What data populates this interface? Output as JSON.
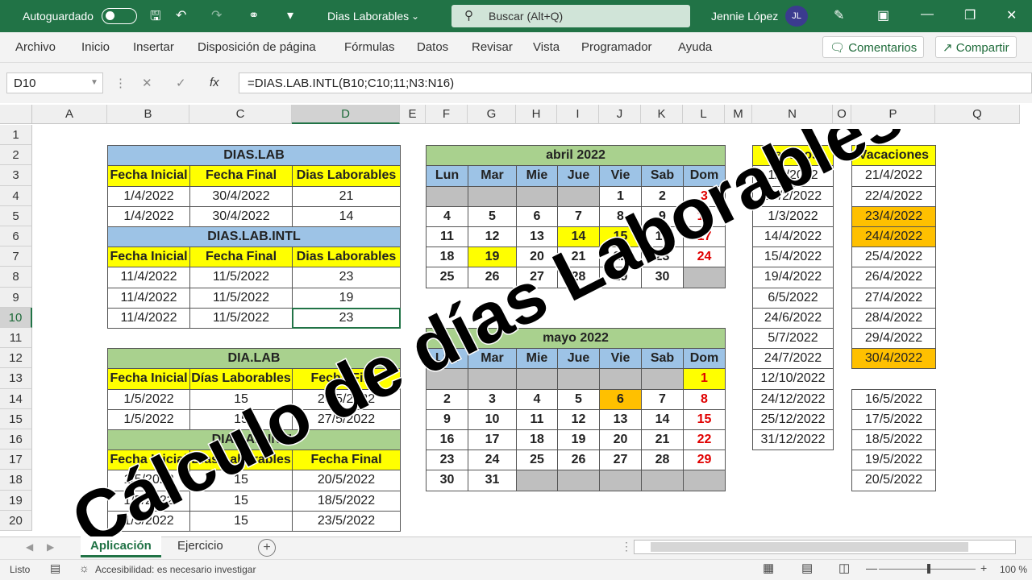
{
  "titlebar": {
    "autosave": "Autoguardado",
    "doc_title": "Dias Laborables",
    "search_placeholder": "Buscar (Alt+Q)",
    "user": "Jennie López",
    "initials": "JL"
  },
  "menu": [
    "Archivo",
    "Inicio",
    "Insertar",
    "Disposición de página",
    "Fórmulas",
    "Datos",
    "Revisar",
    "Vista",
    "Programador",
    "Ayuda"
  ],
  "ribbon_buttons": {
    "comments": "Comentarios",
    "share": "Compartir"
  },
  "formula_bar": {
    "name_box": "D10",
    "formula": "=DIAS.LAB.INTL(B10;C10;11;N3:N16)"
  },
  "columns": [
    "A",
    "B",
    "C",
    "D",
    "E",
    "F",
    "G",
    "H",
    "I",
    "J",
    "K",
    "L",
    "M",
    "N",
    "O",
    "P",
    "Q"
  ],
  "rows": [
    "1",
    "2",
    "3",
    "4",
    "5",
    "6",
    "7",
    "8",
    "9",
    "10",
    "11",
    "12",
    "13",
    "14",
    "15",
    "16",
    "17",
    "18",
    "19",
    "20"
  ],
  "table1": {
    "title": "DIAS.LAB",
    "headers": [
      "Fecha Inicial",
      "Fecha Final",
      "Dias Laborables"
    ],
    "rows": [
      [
        "1/4/2022",
        "30/4/2022",
        "21"
      ],
      [
        "1/4/2022",
        "30/4/2022",
        "14"
      ]
    ]
  },
  "table2": {
    "title": "DIAS.LAB.INTL",
    "headers": [
      "Fecha Inicial",
      "Fecha Final",
      "Dias Laborables"
    ],
    "rows": [
      [
        "11/4/2022",
        "11/5/2022",
        "23"
      ],
      [
        "11/4/2022",
        "11/5/2022",
        "19"
      ],
      [
        "11/4/2022",
        "11/5/2022",
        "23"
      ]
    ]
  },
  "table3": {
    "title": "DIA.LAB",
    "headers": [
      "Fecha Inicial",
      "Días Laborables",
      "Fecha Final"
    ],
    "rows": [
      [
        "1/5/2022",
        "15",
        "20/5/2022"
      ],
      [
        "1/5/2022",
        "15",
        "27/5/2022"
      ]
    ]
  },
  "table4": {
    "title": "DIA.LAB.INTL",
    "headers": [
      "Fecha Inicial",
      "Días Laborables",
      "Fecha Final"
    ],
    "rows": [
      [
        "1/5/2022",
        "15",
        "20/5/2022"
      ],
      [
        "1/5/2022",
        "15",
        "18/5/2022"
      ],
      [
        "1/5/2022",
        "15",
        "23/5/2022"
      ]
    ]
  },
  "cal_april": {
    "title": "abril 2022",
    "days": [
      "Lun",
      "Mar",
      "Mie",
      "Jue",
      "Vie",
      "Sab",
      "Dom"
    ],
    "weeks": [
      [
        "",
        "",
        "",
        "",
        "1",
        "2",
        "3"
      ],
      [
        "4",
        "5",
        "6",
        "7",
        "8",
        "9",
        "10"
      ],
      [
        "11",
        "12",
        "13",
        "14",
        "15",
        "16",
        "17"
      ],
      [
        "18",
        "19",
        "20",
        "21",
        "22",
        "23",
        "24"
      ],
      [
        "25",
        "26",
        "27",
        "28",
        "29",
        "30",
        ""
      ]
    ]
  },
  "cal_may": {
    "title": "mayo 2022",
    "days": [
      "Lun",
      "Mar",
      "Mie",
      "Jue",
      "Vie",
      "Sab",
      "Dom"
    ],
    "weeks": [
      [
        "",
        "",
        "",
        "",
        "",
        "",
        "1"
      ],
      [
        "2",
        "3",
        "4",
        "5",
        "6",
        "7",
        "8"
      ],
      [
        "9",
        "10",
        "11",
        "12",
        "13",
        "14",
        "15"
      ],
      [
        "16",
        "17",
        "18",
        "19",
        "20",
        "21",
        "22"
      ],
      [
        "23",
        "24",
        "25",
        "26",
        "27",
        "28",
        "29"
      ],
      [
        "30",
        "31",
        "",
        "",
        "",
        "",
        ""
      ]
    ]
  },
  "festivos": {
    "title": "Festivos",
    "dates": [
      "1/1/2022",
      "28/2/2022",
      "1/3/2022",
      "14/4/2022",
      "15/4/2022",
      "19/4/2022",
      "6/5/2022",
      "24/6/2022",
      "5/7/2022",
      "24/7/2022",
      "12/10/2022",
      "24/12/2022",
      "25/12/2022",
      "31/12/2022"
    ]
  },
  "vacaciones": {
    "title": "Vacaciones",
    "dates": [
      "21/4/2022",
      "22/4/2022",
      "23/4/2022",
      "24/4/2022",
      "25/4/2022",
      "26/4/2022",
      "27/4/2022",
      "28/4/2022",
      "29/4/2022",
      "30/4/2022"
    ],
    "dates2": [
      "16/5/2022",
      "17/5/2022",
      "18/5/2022",
      "19/5/2022",
      "20/5/2022"
    ]
  },
  "overlay_text": "Cálculo de días Laborables",
  "sheets": [
    "Aplicación",
    "Ejercicio"
  ],
  "status": {
    "ready": "Listo",
    "accessibility": "Accesibilidad: es necesario investigar",
    "zoom": "100 %"
  },
  "colors": {
    "excel_green": "#217346",
    "header_blue": "#9dc3e6",
    "header_green": "#a9d18e",
    "yellow": "#ffff00",
    "orange": "#ffc000",
    "weekend_red": "#e00000"
  }
}
